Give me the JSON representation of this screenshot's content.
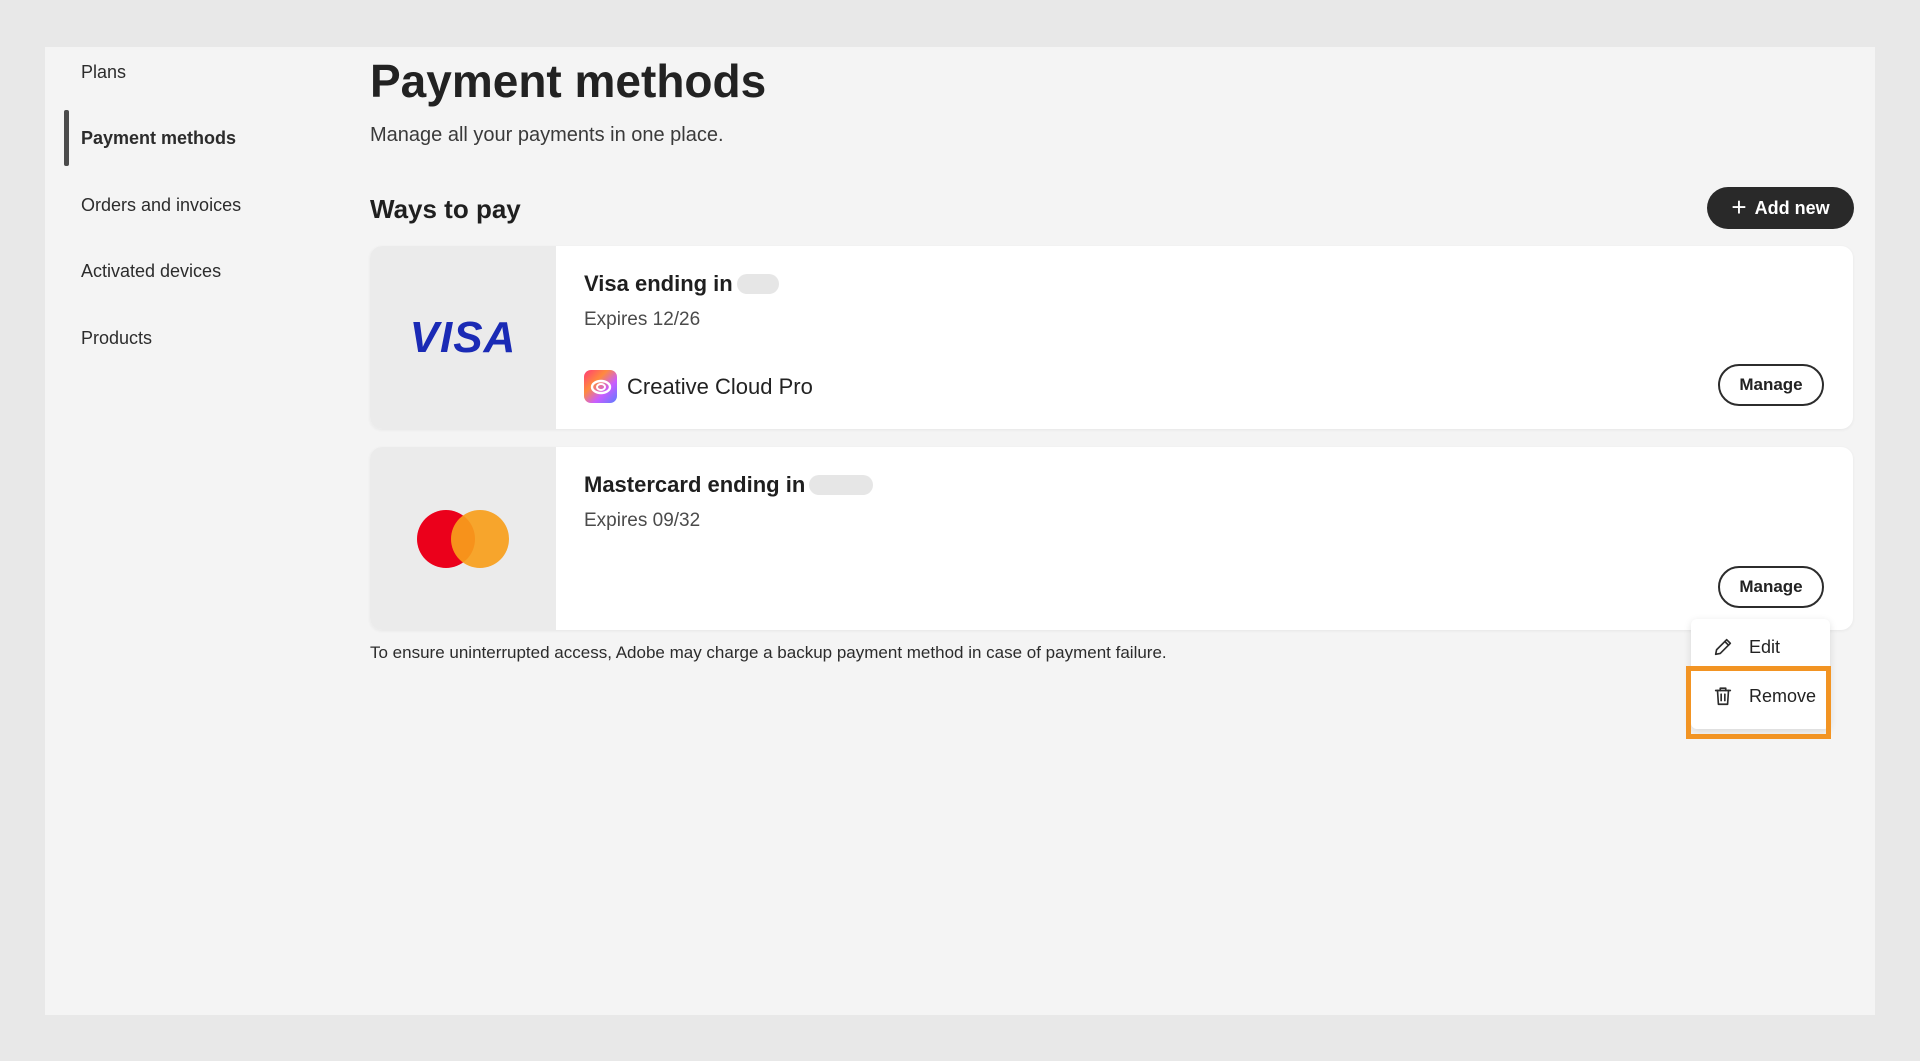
{
  "sidebar": {
    "items": [
      {
        "label": "Plans",
        "active": false
      },
      {
        "label": "Payment methods",
        "active": true
      },
      {
        "label": "Orders and invoices",
        "active": false
      },
      {
        "label": "Activated devices",
        "active": false
      },
      {
        "label": "Products",
        "active": false
      }
    ]
  },
  "header": {
    "title": "Payment methods",
    "subtitle": "Manage all your payments in one place."
  },
  "section": {
    "title": "Ways to pay",
    "add_label": "Add new"
  },
  "cards": [
    {
      "brand": "visa",
      "logo_text": "VISA",
      "title": "Visa ending in",
      "expiry": "Expires 12/26",
      "product": "Creative Cloud Pro",
      "manage_label": "Manage"
    },
    {
      "brand": "mastercard",
      "title": "Mastercard ending in",
      "expiry": "Expires 09/32",
      "manage_label": "Manage"
    }
  ],
  "footnote": "To ensure uninterrupted access, Adobe may charge a backup payment method in case of payment failure.",
  "menu": {
    "edit_label": "Edit",
    "remove_label": "Remove"
  },
  "colors": {
    "visa_blue": "#1a2ab5",
    "mastercard_red": "#eb001b",
    "mastercard_orange": "#f79e1b",
    "highlight": "#f29423",
    "primary_button": "#292929"
  }
}
